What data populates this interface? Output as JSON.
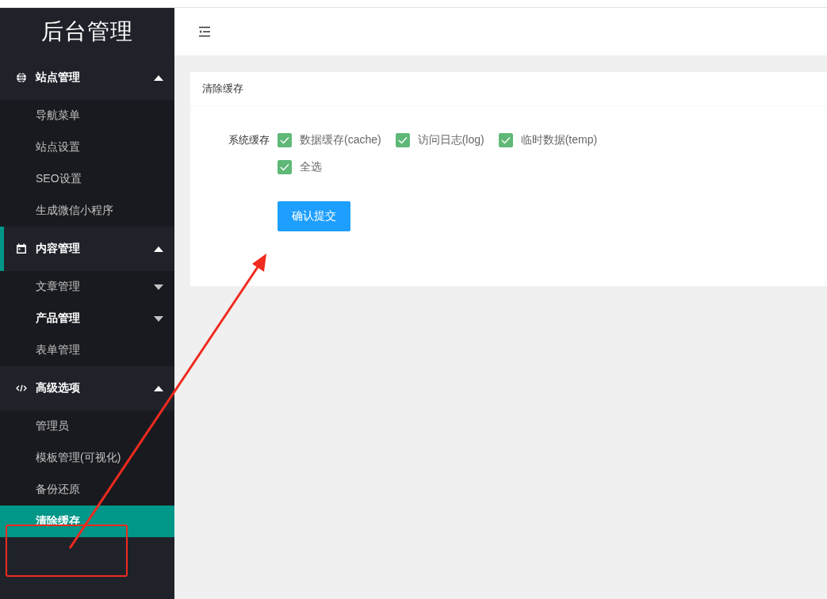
{
  "sidebar": {
    "logo": "后台管理",
    "groups": [
      {
        "title": "站点管理",
        "expanded": true,
        "active": false,
        "items": [
          {
            "label": "导航菜单",
            "kind": "link",
            "hover": false,
            "selected": false
          },
          {
            "label": "站点设置",
            "kind": "link",
            "hover": false,
            "selected": false
          },
          {
            "label": "SEO设置",
            "kind": "link",
            "hover": false,
            "selected": false
          },
          {
            "label": "生成微信小程序",
            "kind": "link",
            "hover": false,
            "selected": false
          }
        ]
      },
      {
        "title": "内容管理",
        "expanded": true,
        "active": true,
        "items": [
          {
            "label": "文章管理",
            "kind": "folder",
            "expanded": false,
            "hover": false,
            "selected": false
          },
          {
            "label": "产品管理",
            "kind": "folder",
            "expanded": false,
            "hover": true,
            "selected": false
          },
          {
            "label": "表单管理",
            "kind": "link",
            "hover": false,
            "selected": false
          }
        ]
      },
      {
        "title": "高级选项",
        "expanded": true,
        "active": false,
        "items": [
          {
            "label": "管理员",
            "kind": "link",
            "hover": false,
            "selected": false
          },
          {
            "label": "模板管理(可视化)",
            "kind": "link",
            "hover": false,
            "selected": false
          },
          {
            "label": "备份还原",
            "kind": "link",
            "hover": false,
            "selected": false
          },
          {
            "label": "清除缓存",
            "kind": "link",
            "hover": false,
            "selected": true
          }
        ]
      }
    ]
  },
  "card": {
    "title": "清除缓存",
    "form_label": "系统缓存",
    "options": [
      {
        "label": "数据缓存(cache)",
        "checked": true
      },
      {
        "label": "访问日志(log)",
        "checked": true
      },
      {
        "label": "临时数据(temp)",
        "checked": true
      }
    ],
    "select_all": {
      "label": "全选",
      "checked": true
    },
    "submit": "确认提交"
  }
}
